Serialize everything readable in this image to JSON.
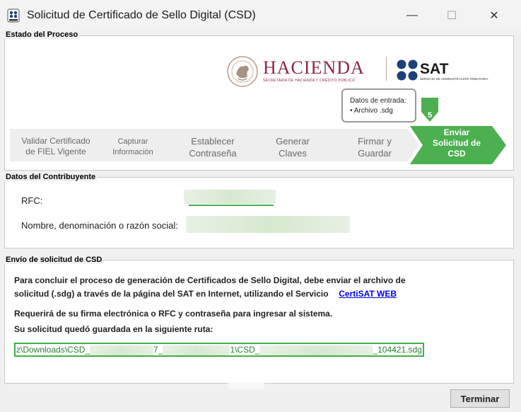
{
  "window": {
    "title": "Solicitud de Certificado de Sello Digital (CSD)",
    "minimize": "—",
    "maximize": "☐",
    "close": "✕"
  },
  "proceso": {
    "heading": "Estado del Proceso",
    "logo": {
      "hacienda": "HACIENDA",
      "hacienda_sub": "SECRETARÍA DE HACIENDA Y CRÉDITO PÚBLICO",
      "sat": "SAT",
      "sat_sub": "SERVICIO DE ADMINISTRACIÓN TRIBUTARIA"
    },
    "tooltip": {
      "title": "Datos de entrada:",
      "item": "• Archivo .sdg"
    },
    "current_step_number": "5",
    "steps": [
      {
        "line1": "Validar Certificado",
        "line2": "de FIEL Vigente"
      },
      {
        "line1": "Capturar",
        "line2": "Información"
      },
      {
        "line1": "Establecer",
        "line2": "Contraseña"
      },
      {
        "line1": "Generar",
        "line2": "Claves"
      },
      {
        "line1": "Firmar y",
        "line2": "Guardar"
      },
      {
        "line1": "Enviar",
        "line2": "Solicitud de",
        "line3": "CSD"
      }
    ],
    "colors": {
      "active": "#4caf50",
      "inactive": "#eeeeee",
      "accent": "#5cb85c"
    }
  },
  "contribuyente": {
    "heading": "Datos del Contribuyente",
    "rfc_label": "RFC:",
    "nombre_label": "Nombre, denominación o razón social:"
  },
  "envio": {
    "heading": "Envío de solicitud de CSD",
    "para1_line1": "Para concluir el proceso de generación de Certificados de Sello Digital, debe enviar el archivo de",
    "para1_line2": "solicitud (.sdg) a través de la página del SAT en Internet, utilizando el Servicio",
    "link": "CertiSAT WEB",
    "para2": "Requerirá de su firma electrónica o RFC y contraseña para ingresar al sistema.",
    "para3": "Su solicitud quedó guardada en la siguiente ruta:",
    "path_parts": [
      "z\\Downloads\\CSD_",
      "7_",
      "1\\CSD_",
      "_104421.sdg"
    ]
  },
  "buttons": {
    "terminar": "Terminar"
  }
}
